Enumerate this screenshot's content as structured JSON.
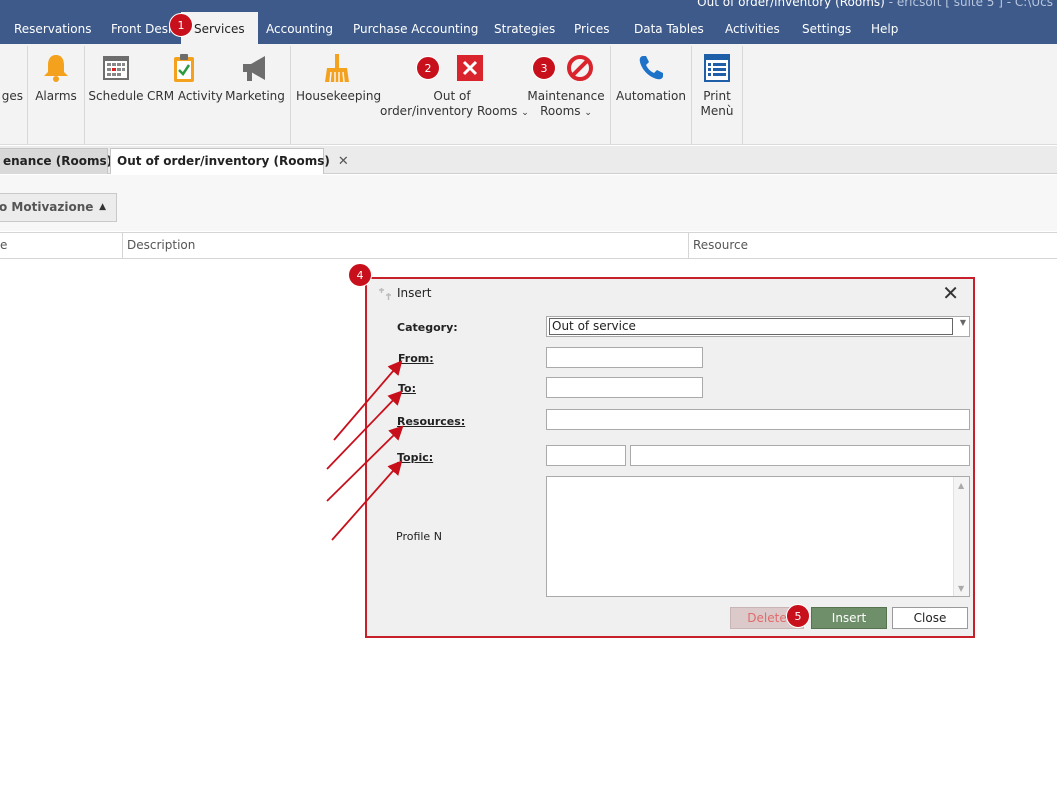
{
  "window": {
    "title": "Out of order/inventory (Rooms)",
    "subtitle": " - ericsoft [ suite 5 ] - C:\\Ucs"
  },
  "menu": {
    "tabs": [
      {
        "label": "Reservations"
      },
      {
        "label": "Front Desk"
      },
      {
        "label": "Services"
      },
      {
        "label": "Accounting"
      },
      {
        "label": "Purchase Accounting"
      },
      {
        "label": "Strategies"
      },
      {
        "label": "Prices"
      },
      {
        "label": "Data Tables"
      },
      {
        "label": "Activities"
      },
      {
        "label": "Settings"
      },
      {
        "label": "Help"
      }
    ],
    "active": "Services"
  },
  "ribbon": {
    "partial": "ges",
    "alarms": "Alarms",
    "schedule": "Schedule",
    "crm": "CRM Activity",
    "marketing": "Marketing",
    "housekeeping": "Housekeeping",
    "ooo_line1": "Out of",
    "ooo_line2": "order/inventory Rooms",
    "maint_line1": "Maintenance",
    "maint_line2": "Rooms",
    "automation": "Automation",
    "print_line1": "Print",
    "print_line2": "Menù",
    "caret": "⌄"
  },
  "doctabs": {
    "maintenance": "enance (Rooms)",
    "ooo": "Out of order/inventory (Rooms)",
    "close": "✕"
  },
  "toolbar": {
    "group_label": "o Motivazione",
    "arrow": "▲"
  },
  "grid": {
    "col1": "e",
    "col2": "Description",
    "col3": "Resource"
  },
  "dialog": {
    "title": "Insert",
    "close": "✕",
    "category_label": "Category:",
    "category_value": "Out of service",
    "dd_arrow": "▼",
    "from_label": "From:",
    "to_label": "To:",
    "resources_label": "Resources:",
    "topic_label": "Topic:",
    "profile_label": "Profile N",
    "sb_up": "▲",
    "sb_down": "▼",
    "delete": "Delete",
    "insert": "Insert",
    "close_btn": "Close"
  },
  "badges": [
    "1",
    "2",
    "3",
    "4",
    "5"
  ],
  "colors": {
    "topbar": "#3d5a8a",
    "badge": "#c8101c",
    "insert_button": "#6e8f6a",
    "dialog_border": "#c8202a"
  }
}
